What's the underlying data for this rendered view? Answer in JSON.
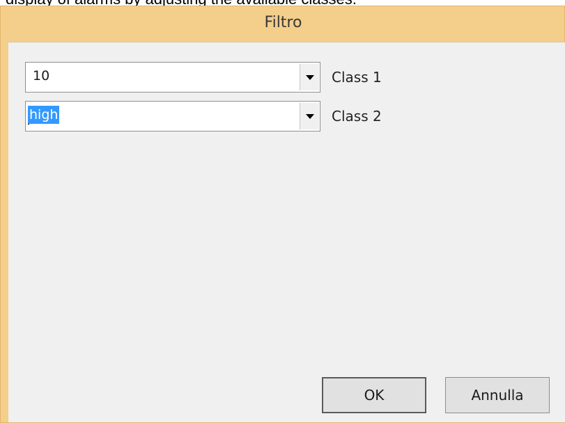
{
  "page": {
    "caption": "display of alarms by adjusting the available classes."
  },
  "dialog": {
    "title": "Filtro",
    "fields": [
      {
        "value": "10",
        "label": "Class 1"
      },
      {
        "value": "high",
        "label": "Class 2"
      }
    ],
    "ok_label": "OK",
    "cancel_label": "Annulla"
  },
  "icons": {
    "dropdown": "chevron-down-icon"
  },
  "colors": {
    "title_bar": "#f4ce8b",
    "selection": "#3399ff"
  }
}
